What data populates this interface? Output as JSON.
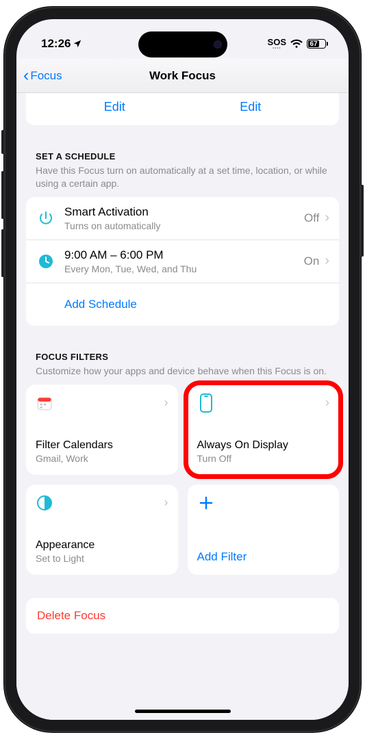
{
  "status": {
    "time": "12:26",
    "sos": "SOS",
    "battery_pct": "67",
    "battery_fill_pct": 67
  },
  "nav": {
    "back_label": "Focus",
    "title": "Work Focus"
  },
  "top_card": {
    "edit_left": "Edit",
    "edit_right": "Edit"
  },
  "schedule": {
    "header": "SET A SCHEDULE",
    "sub": "Have this Focus turn on automatically at a set time, location, or while using a certain app.",
    "rows": [
      {
        "title": "Smart Activation",
        "sub": "Turns on automatically",
        "trail": "Off",
        "icon": "power"
      },
      {
        "title": "9:00 AM – 6:00 PM",
        "sub": "Every Mon, Tue, Wed, and Thu",
        "trail": "On",
        "icon": "clock"
      }
    ],
    "add_label": "Add Schedule"
  },
  "filters": {
    "header": "FOCUS FILTERS",
    "sub": "Customize how your apps and device behave when this Focus is on.",
    "cards": [
      {
        "title": "Filter Calendars",
        "sub": "Gmail, Work",
        "icon": "calendar"
      },
      {
        "title": "Always On Display",
        "sub": "Turn Off",
        "icon": "phone"
      },
      {
        "title": "Appearance",
        "sub": "Set to Light",
        "icon": "appearance"
      }
    ],
    "add_label": "Add Filter"
  },
  "delete_label": "Delete Focus"
}
